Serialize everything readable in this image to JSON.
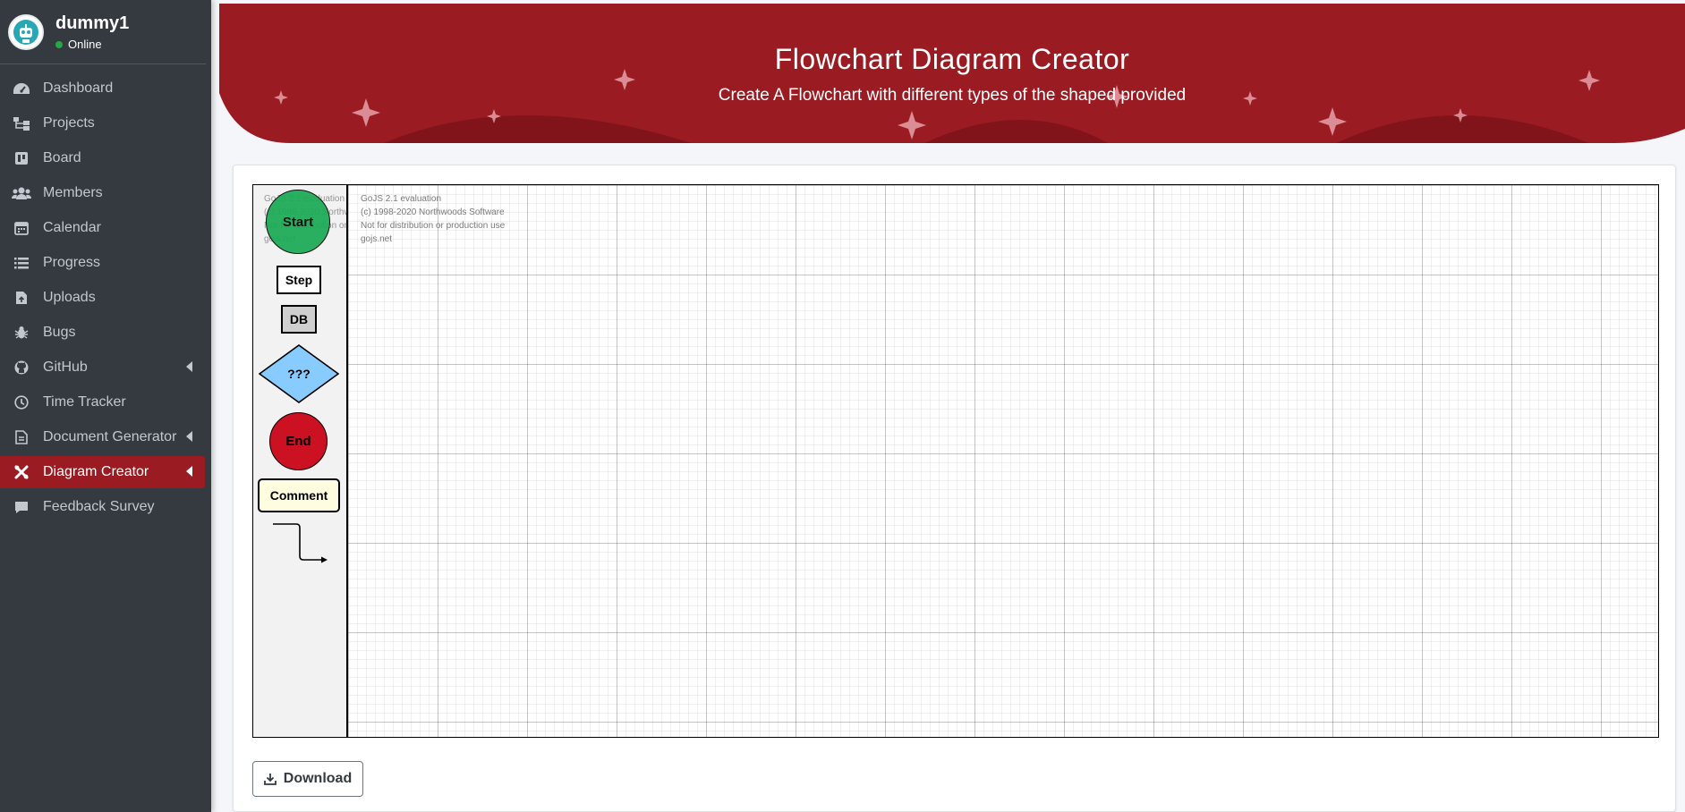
{
  "user": {
    "name": "dummy1",
    "status": "Online"
  },
  "sidebar": {
    "items": [
      {
        "label": "Dashboard",
        "icon": "dashboard-icon"
      },
      {
        "label": "Projects",
        "icon": "sitemap-icon"
      },
      {
        "label": "Board",
        "icon": "board-icon"
      },
      {
        "label": "Members",
        "icon": "users-icon"
      },
      {
        "label": "Calendar",
        "icon": "calendar-icon"
      },
      {
        "label": "Progress",
        "icon": "list-icon"
      },
      {
        "label": "Uploads",
        "icon": "file-upload-icon"
      },
      {
        "label": "Bugs",
        "icon": "bug-icon"
      },
      {
        "label": "GitHub",
        "icon": "github-icon",
        "expandable": true
      },
      {
        "label": "Time Tracker",
        "icon": "clock-icon"
      },
      {
        "label": "Document Generator",
        "icon": "document-icon",
        "expandable": true
      },
      {
        "label": "Diagram Creator",
        "icon": "tools-icon",
        "expandable": true,
        "active": true
      },
      {
        "label": "Feedback Survey",
        "icon": "comment-icon"
      }
    ]
  },
  "header": {
    "title": "Flowchart Diagram Creator",
    "subtitle": "Create A Flowchart with different types of the shaped provided"
  },
  "palette": {
    "start": "Start",
    "step": "Step",
    "db": "DB",
    "decision": "???",
    "end": "End",
    "comment": "Comment",
    "watermark": [
      "GoJS 2.1 evaluation",
      "(c) 1998-2020 Northwoods Software",
      "Not for distribution or production use",
      "gojs.net"
    ]
  },
  "canvas": {
    "watermark": [
      "GoJS 2.1 evaluation",
      "(c) 1998-2020 Northwoods Software",
      "Not for distribution or production use",
      "gojs.net"
    ]
  },
  "actions": {
    "download_label": "Download"
  },
  "colors": {
    "sidebar_bg": "#343a40",
    "accent": "#9b1b22",
    "banner": "#9b1b22",
    "start_shape": "#1aaa55",
    "decision_shape": "#88ccff",
    "end_shape": "#cc1122",
    "comment_shape": "#fffde0"
  }
}
